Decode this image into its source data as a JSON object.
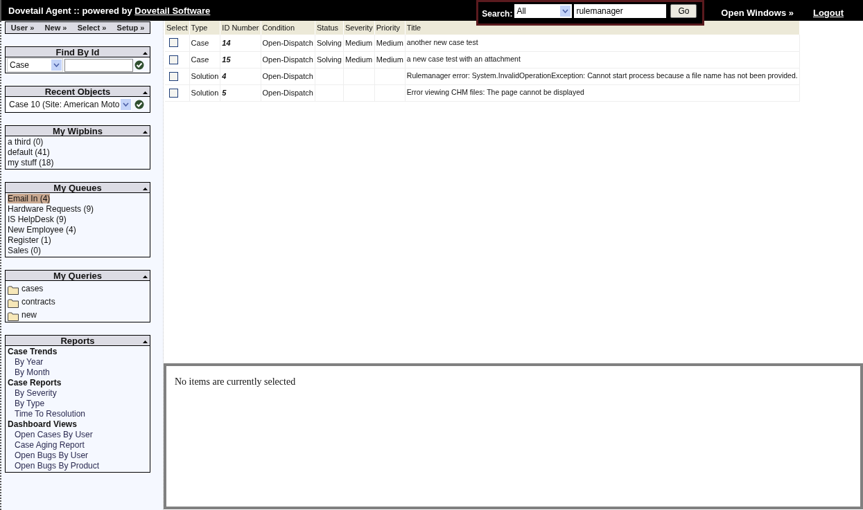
{
  "header": {
    "title": "Dovetail Agent :: powered by ",
    "title_link": "Dovetail Software",
    "search": {
      "label": "Search:",
      "scope": "All",
      "value": "rulemanager",
      "button": "Go"
    },
    "open_windows": "Open Windows »",
    "logout": "Logout"
  },
  "menu": [
    "User »",
    "New »",
    "Select »",
    "Setup »"
  ],
  "find_by_id": {
    "title": "Find By Id",
    "type": "Case"
  },
  "recent_objects": {
    "title": "Recent Objects",
    "value": "Case 10 (Site: American Moto"
  },
  "wipbins": {
    "title": "My Wipbins",
    "items": [
      "a third (0)",
      "default (41)",
      "my stuff (18)"
    ]
  },
  "queues": {
    "title": "My Queues",
    "items": [
      {
        "label": "Email In (4)",
        "selected": true
      },
      {
        "label": "Hardware Requests (9)",
        "selected": false
      },
      {
        "label": "IS HelpDesk (9)",
        "selected": false
      },
      {
        "label": "New Employee (4)",
        "selected": false
      },
      {
        "label": "Register (1)",
        "selected": false
      },
      {
        "label": "Sales (0)",
        "selected": false
      }
    ]
  },
  "queries": {
    "title": "My Queries",
    "items": [
      "cases",
      "contracts",
      "new"
    ]
  },
  "reports": {
    "title": "Reports",
    "groups": [
      {
        "label": "Case Trends",
        "children": [
          "By Year",
          "By Month"
        ]
      },
      {
        "label": "Case Reports",
        "children": [
          "By Severity",
          "By Type",
          "Time To Resolution"
        ]
      },
      {
        "label": "Dashboard Views",
        "children": [
          "Open Cases By User",
          "Case Aging Report",
          "Open Bugs By User",
          "Open Bugs By Product"
        ]
      }
    ]
  },
  "table": {
    "columns": [
      "Select",
      "Type",
      "ID Number",
      "Condition",
      "Status",
      "Severity",
      "Priority",
      "Title"
    ],
    "rows": [
      {
        "checked": false,
        "type": "Case",
        "id": "14",
        "condition": "Open-Dispatch",
        "status": "Solving",
        "severity": "Medium",
        "priority": "Medium",
        "title": "another new case test"
      },
      {
        "checked": false,
        "type": "Case",
        "id": "15",
        "condition": "Open-Dispatch",
        "status": "Solving",
        "severity": "Medium",
        "priority": "Medium",
        "title": "a new case test with an attachment"
      },
      {
        "checked": false,
        "type": "Solution",
        "id": "4",
        "condition": "Open-Dispatch",
        "title": "Rulemanager error: System.InvalidOperationException: Cannot start process because a file name has not been provided."
      },
      {
        "checked": false,
        "type": "Solution",
        "id": "5",
        "condition": "Open-Dispatch",
        "title": "Error viewing CHM files: The page cannot be displayed"
      }
    ]
  },
  "detail": {
    "message": "No items are currently selected"
  }
}
